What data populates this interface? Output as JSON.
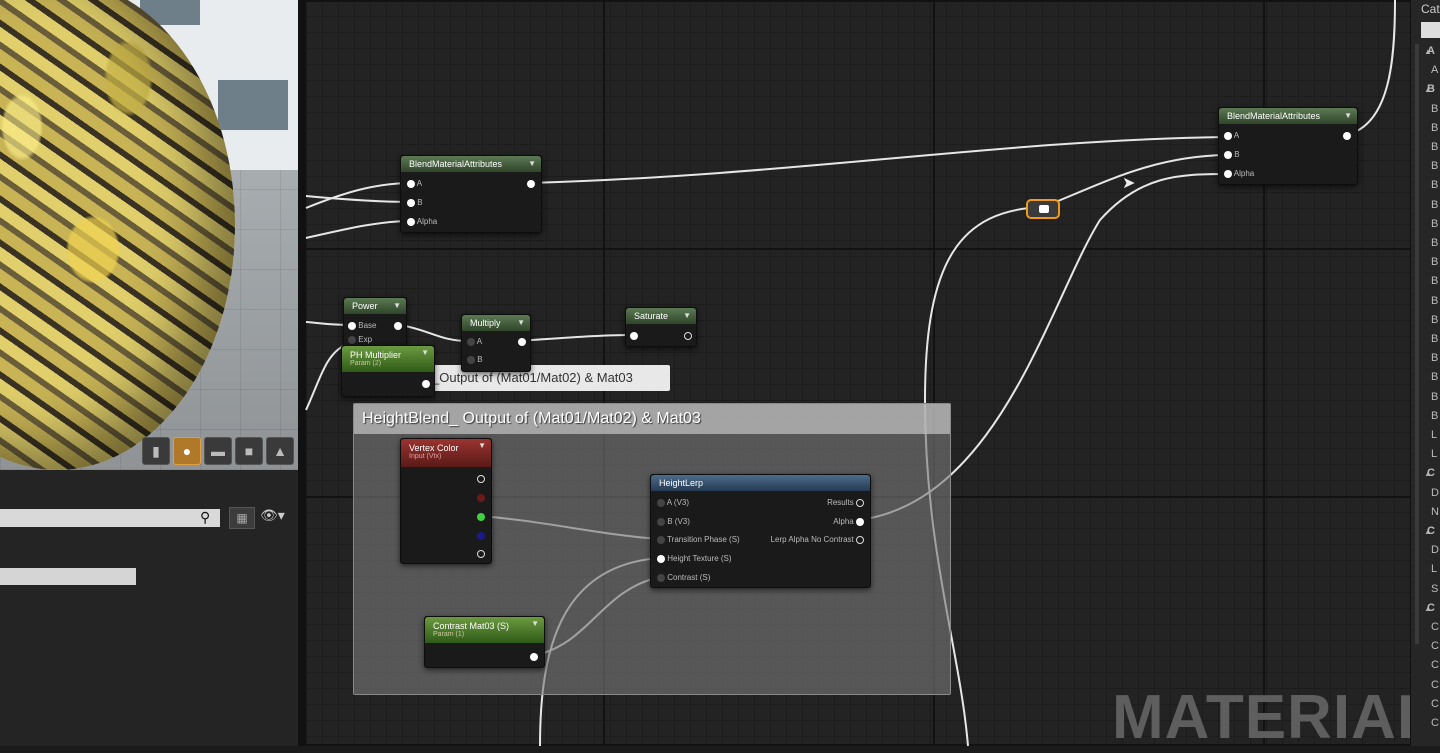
{
  "viewport": {
    "toolbar": [
      "cylinder-icon",
      "sphere-icon",
      "plane-icon",
      "cube-icon",
      "teapot-icon"
    ],
    "active_index": 1
  },
  "search": {
    "placeholder": ""
  },
  "graph": {
    "comment_title": "HeightBlend_ Output of (Mat01/Mat02)  & Mat03",
    "comment_tooltip": "_Output of (Mat01/Mat02) & Mat03",
    "watermark": "MATERIAL",
    "nodes": {
      "blend1": {
        "title": "BlendMaterialAttributes",
        "pins": [
          "A",
          "B",
          "Alpha"
        ]
      },
      "blend2": {
        "title": "BlendMaterialAttributes",
        "pins": [
          "A",
          "B",
          "Alpha"
        ]
      },
      "power": {
        "title": "Power",
        "pins": [
          "Base",
          "Exp"
        ]
      },
      "ph_multiplier": {
        "title": "PH Multiplier",
        "subtitle": "Param (2)"
      },
      "multiply": {
        "title": "Multiply",
        "pins": [
          "A",
          "B"
        ]
      },
      "saturate": {
        "title": "Saturate"
      },
      "vertex_color": {
        "title": "Vertex Color",
        "subtitle": "Input (Vtx)"
      },
      "height_lerp": {
        "title": "HeightLerp",
        "inputs": [
          "A (V3)",
          "B (V3)",
          "Transition Phase (S)",
          "Height Texture (S)",
          "Contrast (S)"
        ],
        "outputs": [
          "Results",
          "Alpha",
          "Lerp Alpha No Contrast"
        ]
      },
      "contrast": {
        "title": "Contrast Mat03 (S)",
        "subtitle": "Param (1)"
      }
    }
  },
  "details": {
    "header": "Cat",
    "rows": [
      {
        "arrow": "▲",
        "text": "A"
      },
      {
        "text": "A"
      },
      {
        "arrow": "▲",
        "text": "B"
      },
      {
        "text": "B"
      },
      {
        "text": "B"
      },
      {
        "text": "B"
      },
      {
        "text": "B"
      },
      {
        "text": "B"
      },
      {
        "text": "B"
      },
      {
        "text": "B"
      },
      {
        "text": "B"
      },
      {
        "text": "B"
      },
      {
        "text": "B"
      },
      {
        "text": "B"
      },
      {
        "text": "B"
      },
      {
        "text": "B"
      },
      {
        "text": "B"
      },
      {
        "text": "B"
      },
      {
        "text": "B"
      },
      {
        "text": "B"
      },
      {
        "text": "L"
      },
      {
        "text": "L"
      },
      {
        "arrow": "▲",
        "text": "C"
      },
      {
        "text": "D"
      },
      {
        "text": "N"
      },
      {
        "arrow": "▲",
        "text": "C"
      },
      {
        "text": "D"
      },
      {
        "text": "L"
      },
      {
        "text": "S"
      },
      {
        "arrow": "▲",
        "text": "C"
      },
      {
        "text": "C"
      },
      {
        "text": "C"
      },
      {
        "text": "C"
      },
      {
        "text": "C"
      },
      {
        "text": "C"
      },
      {
        "text": "C"
      }
    ]
  }
}
